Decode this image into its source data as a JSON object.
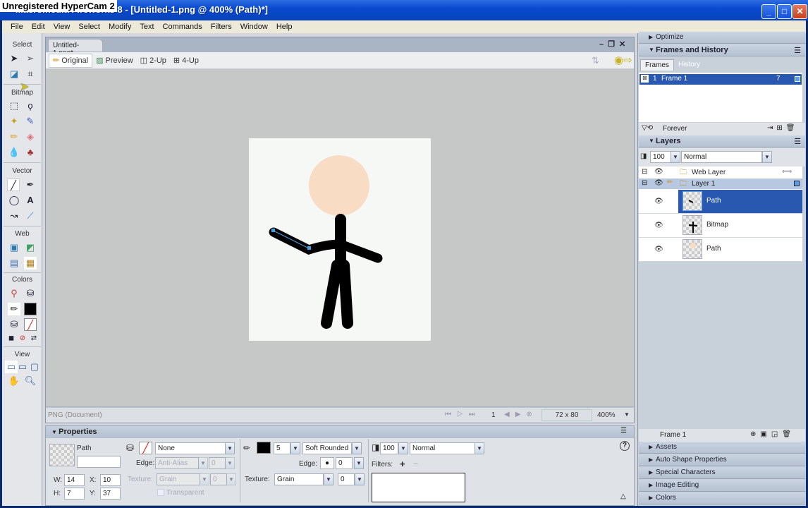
{
  "overlay": {
    "watermark": "Unregistered HyperCam 2"
  },
  "window": {
    "title": "Macromedia Fireworks 8 - [Untitled-1.png @ 400% (Path)*]",
    "min": "_",
    "max": "□",
    "close": "✕"
  },
  "menu": [
    "File",
    "Edit",
    "View",
    "Select",
    "Modify",
    "Text",
    "Commands",
    "Filters",
    "Window",
    "Help"
  ],
  "tools": {
    "sections": [
      "Select",
      "Bitmap",
      "Vector",
      "Web",
      "Colors",
      "View"
    ],
    "stroke_color": "#000000"
  },
  "document": {
    "tab": "Untitled-1.png*",
    "views": [
      "Original",
      "Preview",
      "2-Up",
      "4-Up"
    ],
    "active_view": "Original",
    "status_left": "PNG (Document)",
    "frame_number": "1",
    "size": "72 x 80",
    "zoom": "400%"
  },
  "properties": {
    "title": "Properties",
    "object_type": "Path",
    "object_name": "",
    "w_label": "W:",
    "w": "14",
    "h_label": "H:",
    "h": "7",
    "x_label": "X:",
    "x": "10",
    "y_label": "Y:",
    "y": "37",
    "fill": "None",
    "fill_edge_label": "Edge:",
    "fill_edge": "Anti-Alias",
    "fill_edge_value": "0",
    "fill_texture_label": "Texture:",
    "fill_texture": "Grain",
    "fill_texture_value": "0",
    "transparent_label": "Transparent",
    "stroke_size": "5",
    "stroke_type": "Soft Rounded",
    "stroke_edge_label": "Edge:",
    "stroke_edge_value": "0",
    "stroke_texture_label": "Texture:",
    "stroke_texture": "Grain",
    "stroke_texture_value": "0",
    "opacity": "100",
    "blend": "Normal",
    "filters_label": "Filters:",
    "filters_add": "+",
    "filters_remove": "−",
    "help": "?"
  },
  "panels": {
    "optimize": "Optimize",
    "frames_history": "Frames and History",
    "tabs": [
      "Frames",
      "History"
    ],
    "frames": [
      {
        "num": "1",
        "name": "Frame 1",
        "delay": "7"
      }
    ],
    "loop": "Forever",
    "layers_title": "Layers",
    "layer_opacity": "100",
    "layer_blend": "Normal",
    "layers": [
      {
        "name": "Web Layer",
        "type": "folder"
      },
      {
        "name": "Layer 1",
        "type": "folder"
      }
    ],
    "objects": [
      {
        "name": "Path",
        "selected": true
      },
      {
        "name": "Bitmap",
        "selected": false
      },
      {
        "name": "Path",
        "selected": false
      }
    ],
    "current_frame": "Frame 1",
    "collapsed": [
      "Assets",
      "Auto Shape Properties",
      "Special Characters",
      "Image Editing",
      "Colors"
    ]
  },
  "colors": {
    "accent": "#2c5cb8",
    "selection": "#2858b0",
    "head": "#f8dcc4"
  }
}
